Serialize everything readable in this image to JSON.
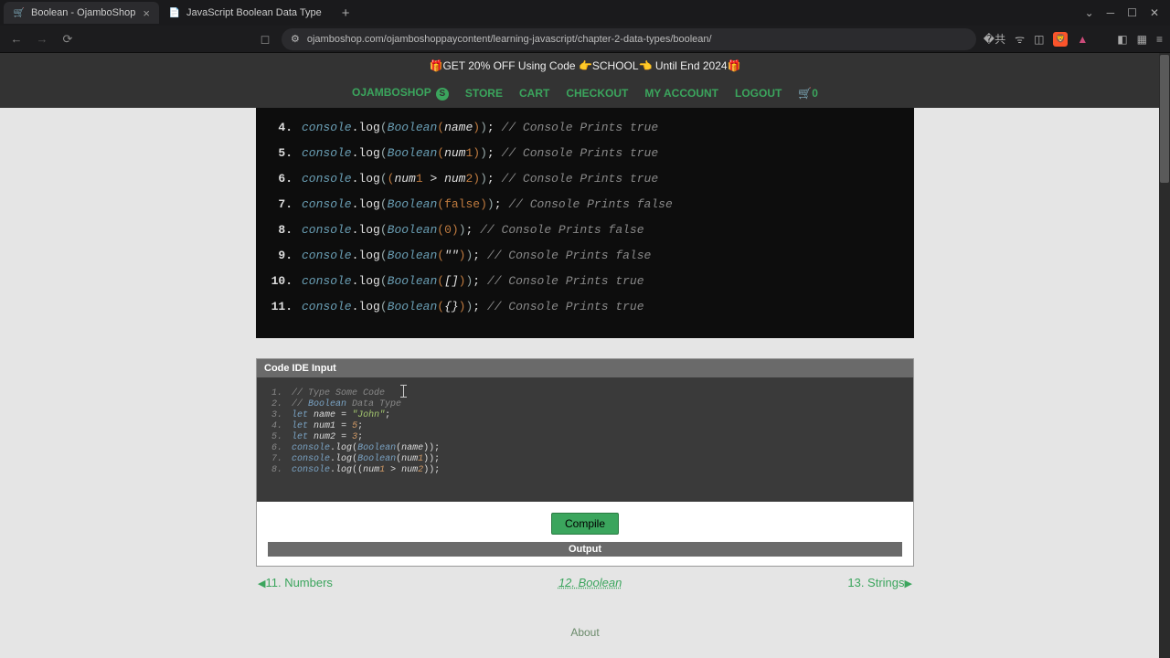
{
  "browser": {
    "tabs": [
      {
        "title": "Boolean - OjamboShop",
        "active": true
      },
      {
        "title": "JavaScript Boolean Data Type",
        "active": false
      }
    ],
    "url": "ojamboshop.com/ojamboshoppaycontent/learning-javascript/chapter-2-data-types/boolean/"
  },
  "promo": "🎁GET 20% OFF Using Code 👉SCHOOL👈 Until End 2024🎁",
  "nav": {
    "brand": "OJAMBOSHOP",
    "items": [
      "STORE",
      "CART",
      "CHECKOUT",
      "MY ACCOUNT",
      "LOGOUT"
    ],
    "cart_count": "0"
  },
  "example_code": [
    {
      "n": "4.",
      "obj": "console",
      "fn": ".log",
      "call": "Boolean",
      "args": "name",
      "comment": "// Console Prints true"
    },
    {
      "n": "5.",
      "obj": "console",
      "fn": ".log",
      "call": "Boolean",
      "args": "num1",
      "comment": "// Console Prints true"
    },
    {
      "n": "6.",
      "obj": "console",
      "fn": ".log",
      "expr": "(num1 > num2)",
      "comment": "// Console Prints true"
    },
    {
      "n": "7.",
      "obj": "console",
      "fn": ".log",
      "call": "Boolean",
      "args": "false",
      "comment": "// Console Prints false"
    },
    {
      "n": "8.",
      "obj": "console",
      "fn": ".log",
      "call": "Boolean",
      "args": "0",
      "comment": "// Console Prints false"
    },
    {
      "n": "9.",
      "obj": "console",
      "fn": ".log",
      "call": "Boolean",
      "args": "\"\"",
      "comment": "// Console Prints false"
    },
    {
      "n": "10.",
      "obj": "console",
      "fn": ".log",
      "call": "Boolean",
      "args": "[]",
      "comment": "// Console Prints true"
    },
    {
      "n": "11.",
      "obj": "console",
      "fn": ".log",
      "call": "Boolean",
      "args": "{}",
      "comment": "// Console Prints true"
    }
  ],
  "ide": {
    "header": "Code IDE Input",
    "lines": [
      "// Type Some Code",
      "// Boolean Data Type",
      "let name = \"John\";",
      "let num1 = 5;",
      "let num2 = 3;",
      "console.log(Boolean(name));",
      "console.log(Boolean(num1));",
      "console.log((num1 > num2));"
    ],
    "compile_label": "Compile",
    "output_label": "Output"
  },
  "pagination": {
    "prev": "11. Numbers",
    "current": "12. Boolean",
    "next": "13. Strings"
  },
  "footer": {
    "about": "About"
  }
}
